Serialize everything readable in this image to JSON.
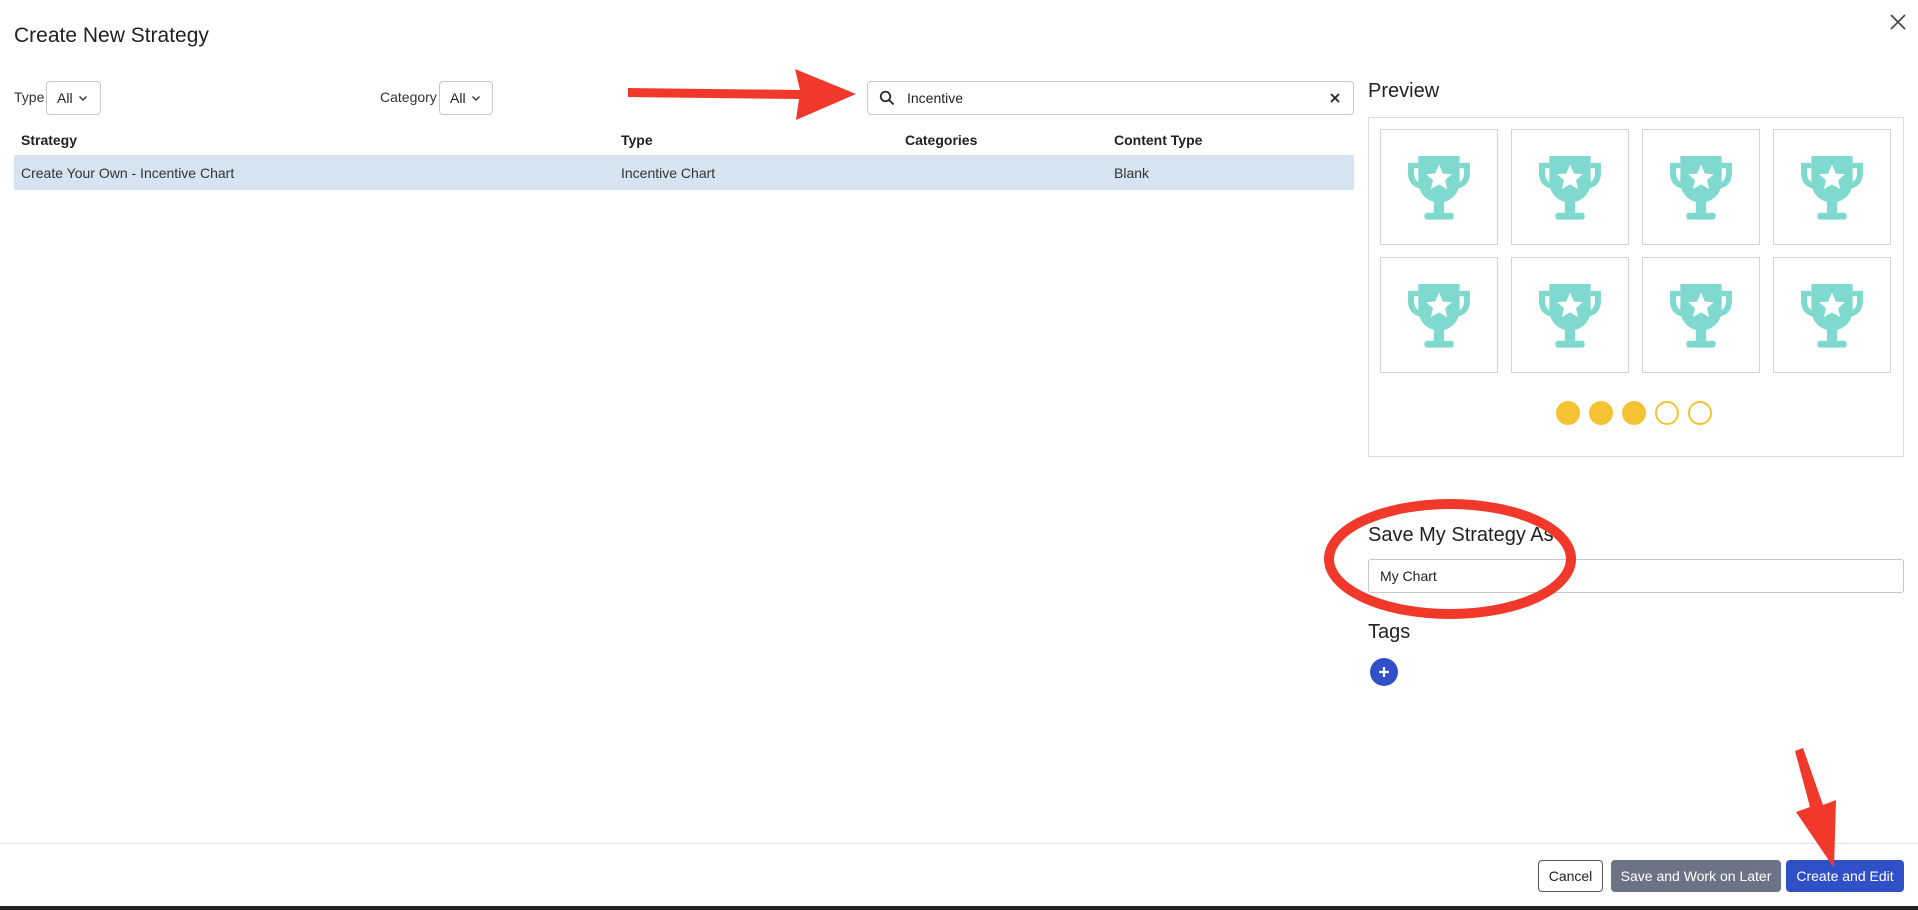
{
  "dialog": {
    "title": "Create New Strategy"
  },
  "filters": {
    "type_label": "Type",
    "type_value": "All",
    "category_label": "Category",
    "category_value": "All"
  },
  "search": {
    "value": "Incentive"
  },
  "table": {
    "headers": [
      "Strategy",
      "Type",
      "Categories",
      "Content Type"
    ],
    "rows": [
      {
        "strategy": "Create Your Own - Incentive Chart",
        "type": "Incentive Chart",
        "categories": "",
        "content_type": "Blank"
      }
    ]
  },
  "preview": {
    "title": "Preview",
    "tile_icon": "trophy-icon",
    "tile_color": "#7fd9cf",
    "progress_filled": 3,
    "progress_total": 5,
    "progress_color": "#f5c233"
  },
  "save_as": {
    "label": "Save My Strategy As",
    "value": "My Chart"
  },
  "tags": {
    "label": "Tags"
  },
  "footer": {
    "cancel_label": "Cancel",
    "save_later_label": "Save and Work on Later",
    "create_label": "Create and Edit"
  },
  "annotation_color": "#f0392b"
}
